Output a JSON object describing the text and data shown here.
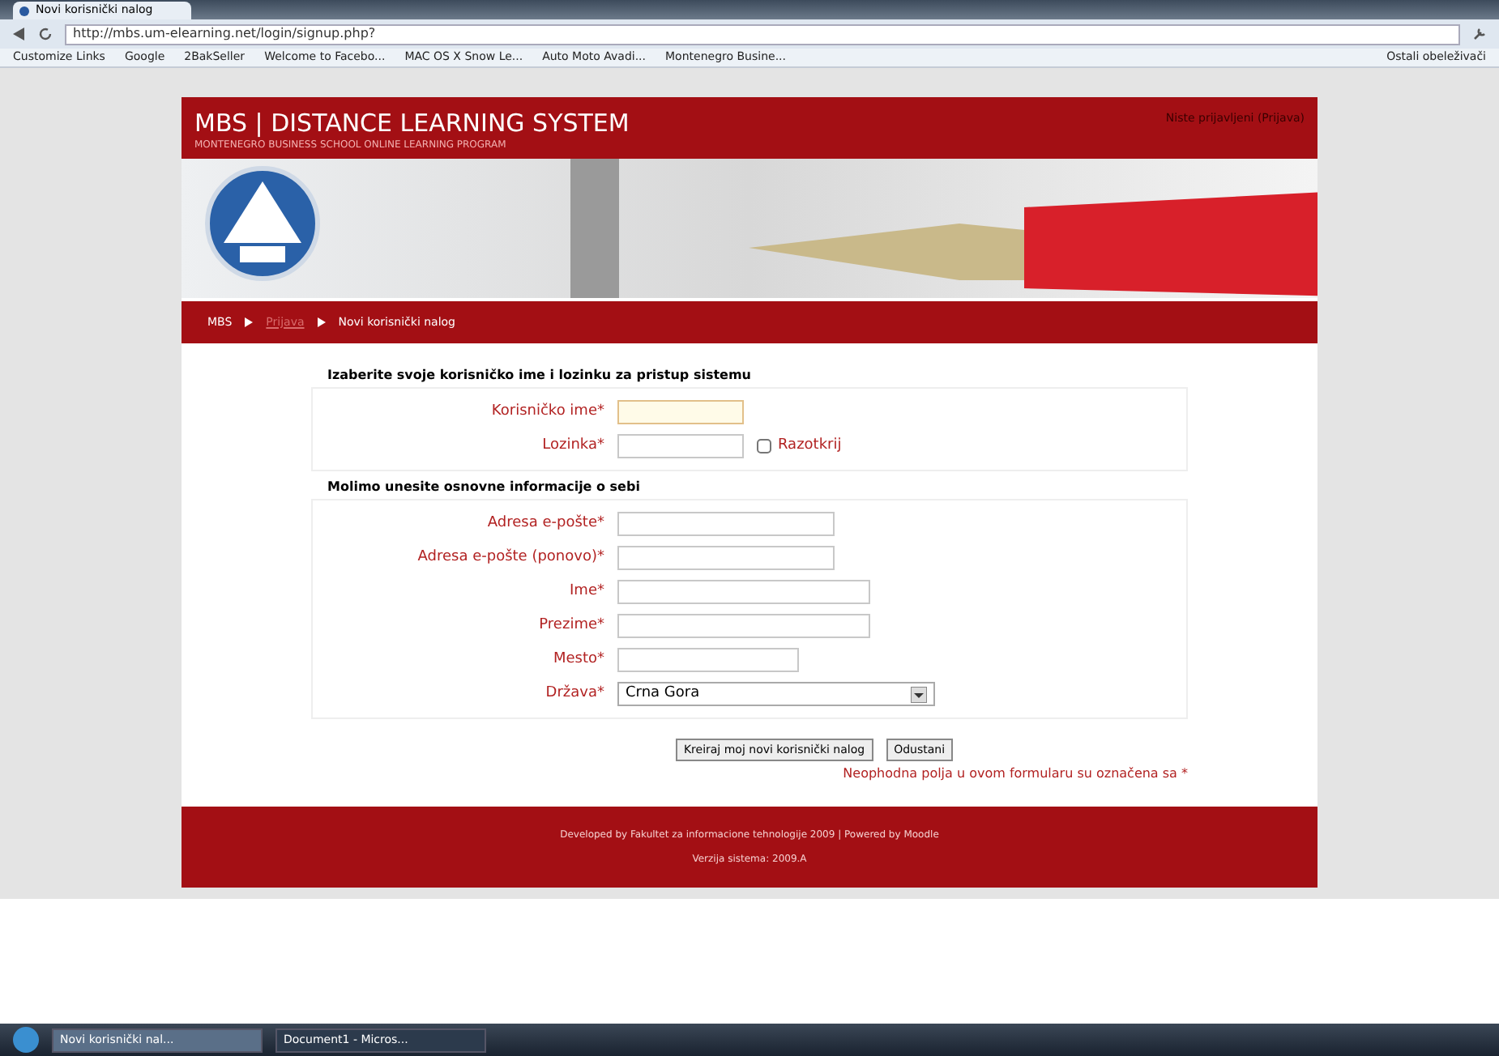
{
  "browser": {
    "tab_title": "Novi korisnički nalog",
    "url": "http://mbs.um-elearning.net/login/signup.php?",
    "bookmarks": [
      "Customize Links",
      "Google",
      "2BakSeller",
      "Welcome to Facebo...",
      "MAC OS X Snow Le...",
      "Auto Moto Avadi...",
      "Montenegro Busine..."
    ],
    "other_bookmarks": "Ostali obeleživači"
  },
  "header": {
    "title": "MBS | DISTANCE LEARNING SYSTEM",
    "subtitle": "MONTENEGRO BUSINESS SCHOOL ONLINE LEARNING PROGRAM",
    "login_info": "Niste prijavljeni (Prijava)"
  },
  "breadcrumb": [
    {
      "label": "MBS",
      "link": false
    },
    {
      "label": "Prijava",
      "link": true
    },
    {
      "label": "Novi korisnički nalog",
      "link": false
    }
  ],
  "sections": [
    {
      "title": "Izaberite svoje korisničko ime i lozinku za pristup sistemu",
      "fields": [
        {
          "kind": "text",
          "label": "Korisničko ime*",
          "focused": true
        },
        {
          "kind": "password",
          "label": "Lozinka*",
          "focused": false,
          "checkbox": {
            "label": "Razotkrij",
            "checked": false
          }
        }
      ]
    },
    {
      "title": "Molimo unesite osnovne informacije o sebi",
      "fields": [
        {
          "kind": "text",
          "label": "Adresa e-pošte*",
          "focused": false
        },
        {
          "kind": "text",
          "label": "Adresa e-pošte (ponovo)*",
          "focused": false
        },
        {
          "kind": "text",
          "label": "Ime*",
          "focused": false
        },
        {
          "kind": "text",
          "label": "Prezime*",
          "focused": false
        },
        {
          "kind": "text",
          "label": "Mesto*",
          "focused": false
        },
        {
          "kind": "select",
          "label": "Država*",
          "value": "Crna Gora"
        }
      ]
    }
  ],
  "buttons": [
    "Kreiraj moj novi korisnički nalog",
    "Odustani"
  ],
  "required_note": "Neophodna polja u ovom formularu su označena sa *",
  "footer": [
    "Developed by Fakultet za informacione tehnologije 2009 | Powered by Moodle",
    "Verzija sistema: 2009.A"
  ],
  "taskbar": {
    "windows": [
      {
        "label": "Novi korisnički nal...",
        "selected": true
      },
      {
        "label": "Document1 - Micros...",
        "selected": false
      }
    ]
  }
}
